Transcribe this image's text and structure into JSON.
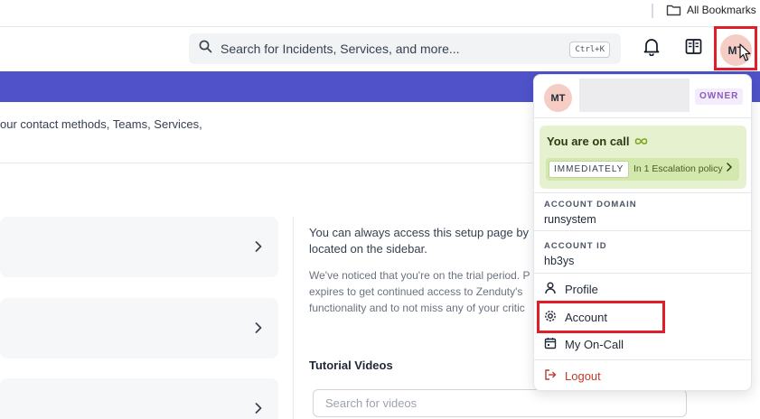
{
  "browser": {
    "bookmarks_label": "All Bookmarks",
    "folder_icon": "folder-icon"
  },
  "header": {
    "search_placeholder": "Search for Incidents, Services, and more...",
    "shortcut": "Ctrl+K",
    "search_icon": "search-icon",
    "notifications_icon": "bell-icon",
    "docs_icon": "docs-icon",
    "avatar_initials": "MT"
  },
  "main": {
    "intro_text": "our contact methods, Teams, Services,",
    "info_main": "You can always access this setup page by located on the sidebar.",
    "info_sub": "We've noticed that you're on the trial period. P expires to get continued access to Zenduty's functionality and to not miss any of your critic",
    "tutorial_title": "Tutorial Videos",
    "video_search_placeholder": "Search for videos"
  },
  "user_menu": {
    "avatar_initials": "MT",
    "role_badge": "OWNER",
    "oncall_status": "You are on call",
    "oncall_icon": "infinity-icon",
    "urgency": "IMMEDIATELY",
    "escalation_text": "In 1 Escalation policy",
    "account_domain_label": "ACCOUNT DOMAIN",
    "account_domain_value": "runsystem",
    "account_id_label": "ACCOUNT ID",
    "account_id_value": "hb3ys",
    "items": [
      {
        "label": "Profile",
        "icon": "person-icon"
      },
      {
        "label": "Account",
        "icon": "gear-icon"
      },
      {
        "label": "My On-Call",
        "icon": "calendar-icon"
      },
      {
        "label": "Logout",
        "icon": "logout-icon"
      }
    ]
  },
  "colors": {
    "banner": "#4f52c9",
    "highlight": "#e11d2a",
    "oncall_bg": "#e6f2cf",
    "owner_badge": "#8b5bbf",
    "logout": "#c0392b"
  }
}
